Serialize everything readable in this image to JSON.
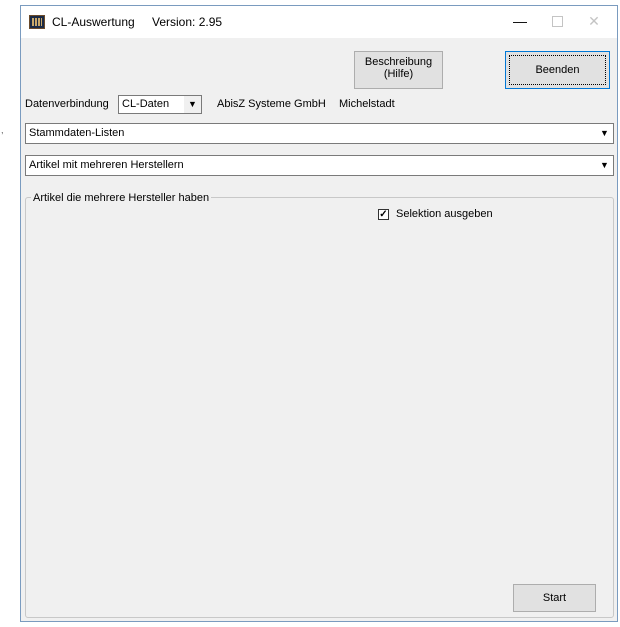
{
  "window": {
    "title": "CL-Auswertung",
    "version": "Version: 2.95",
    "min_glyph": "—",
    "max_glyph": "",
    "close_glyph": "✕"
  },
  "toolbar": {
    "beschreibung_line1": "Beschreibung",
    "beschreibung_line2": "(Hilfe)",
    "beenden_label": "Beenden"
  },
  "connection": {
    "label": "Datenverbindung",
    "selected": "CL-Daten",
    "company": "AbisZ Systeme GmbH",
    "city": "Michelstadt"
  },
  "category_select": {
    "selected": "Stammdaten-Listen"
  },
  "report_select": {
    "selected": "Artikel mit mehreren Herstellern"
  },
  "group": {
    "title": "Artikel die mehrere Hersteller haben",
    "checkbox_label": "Selektion ausgeben",
    "checkbox_checked": true,
    "check_glyph": "✓"
  },
  "actions": {
    "start_label": "Start"
  },
  "icons": {
    "app": "app-icon",
    "dropdown": "chevron-down-icon"
  },
  "colors": {
    "window_border": "#7a9bbf",
    "focus_border": "#0078d7",
    "face": "#f0f0f0"
  }
}
